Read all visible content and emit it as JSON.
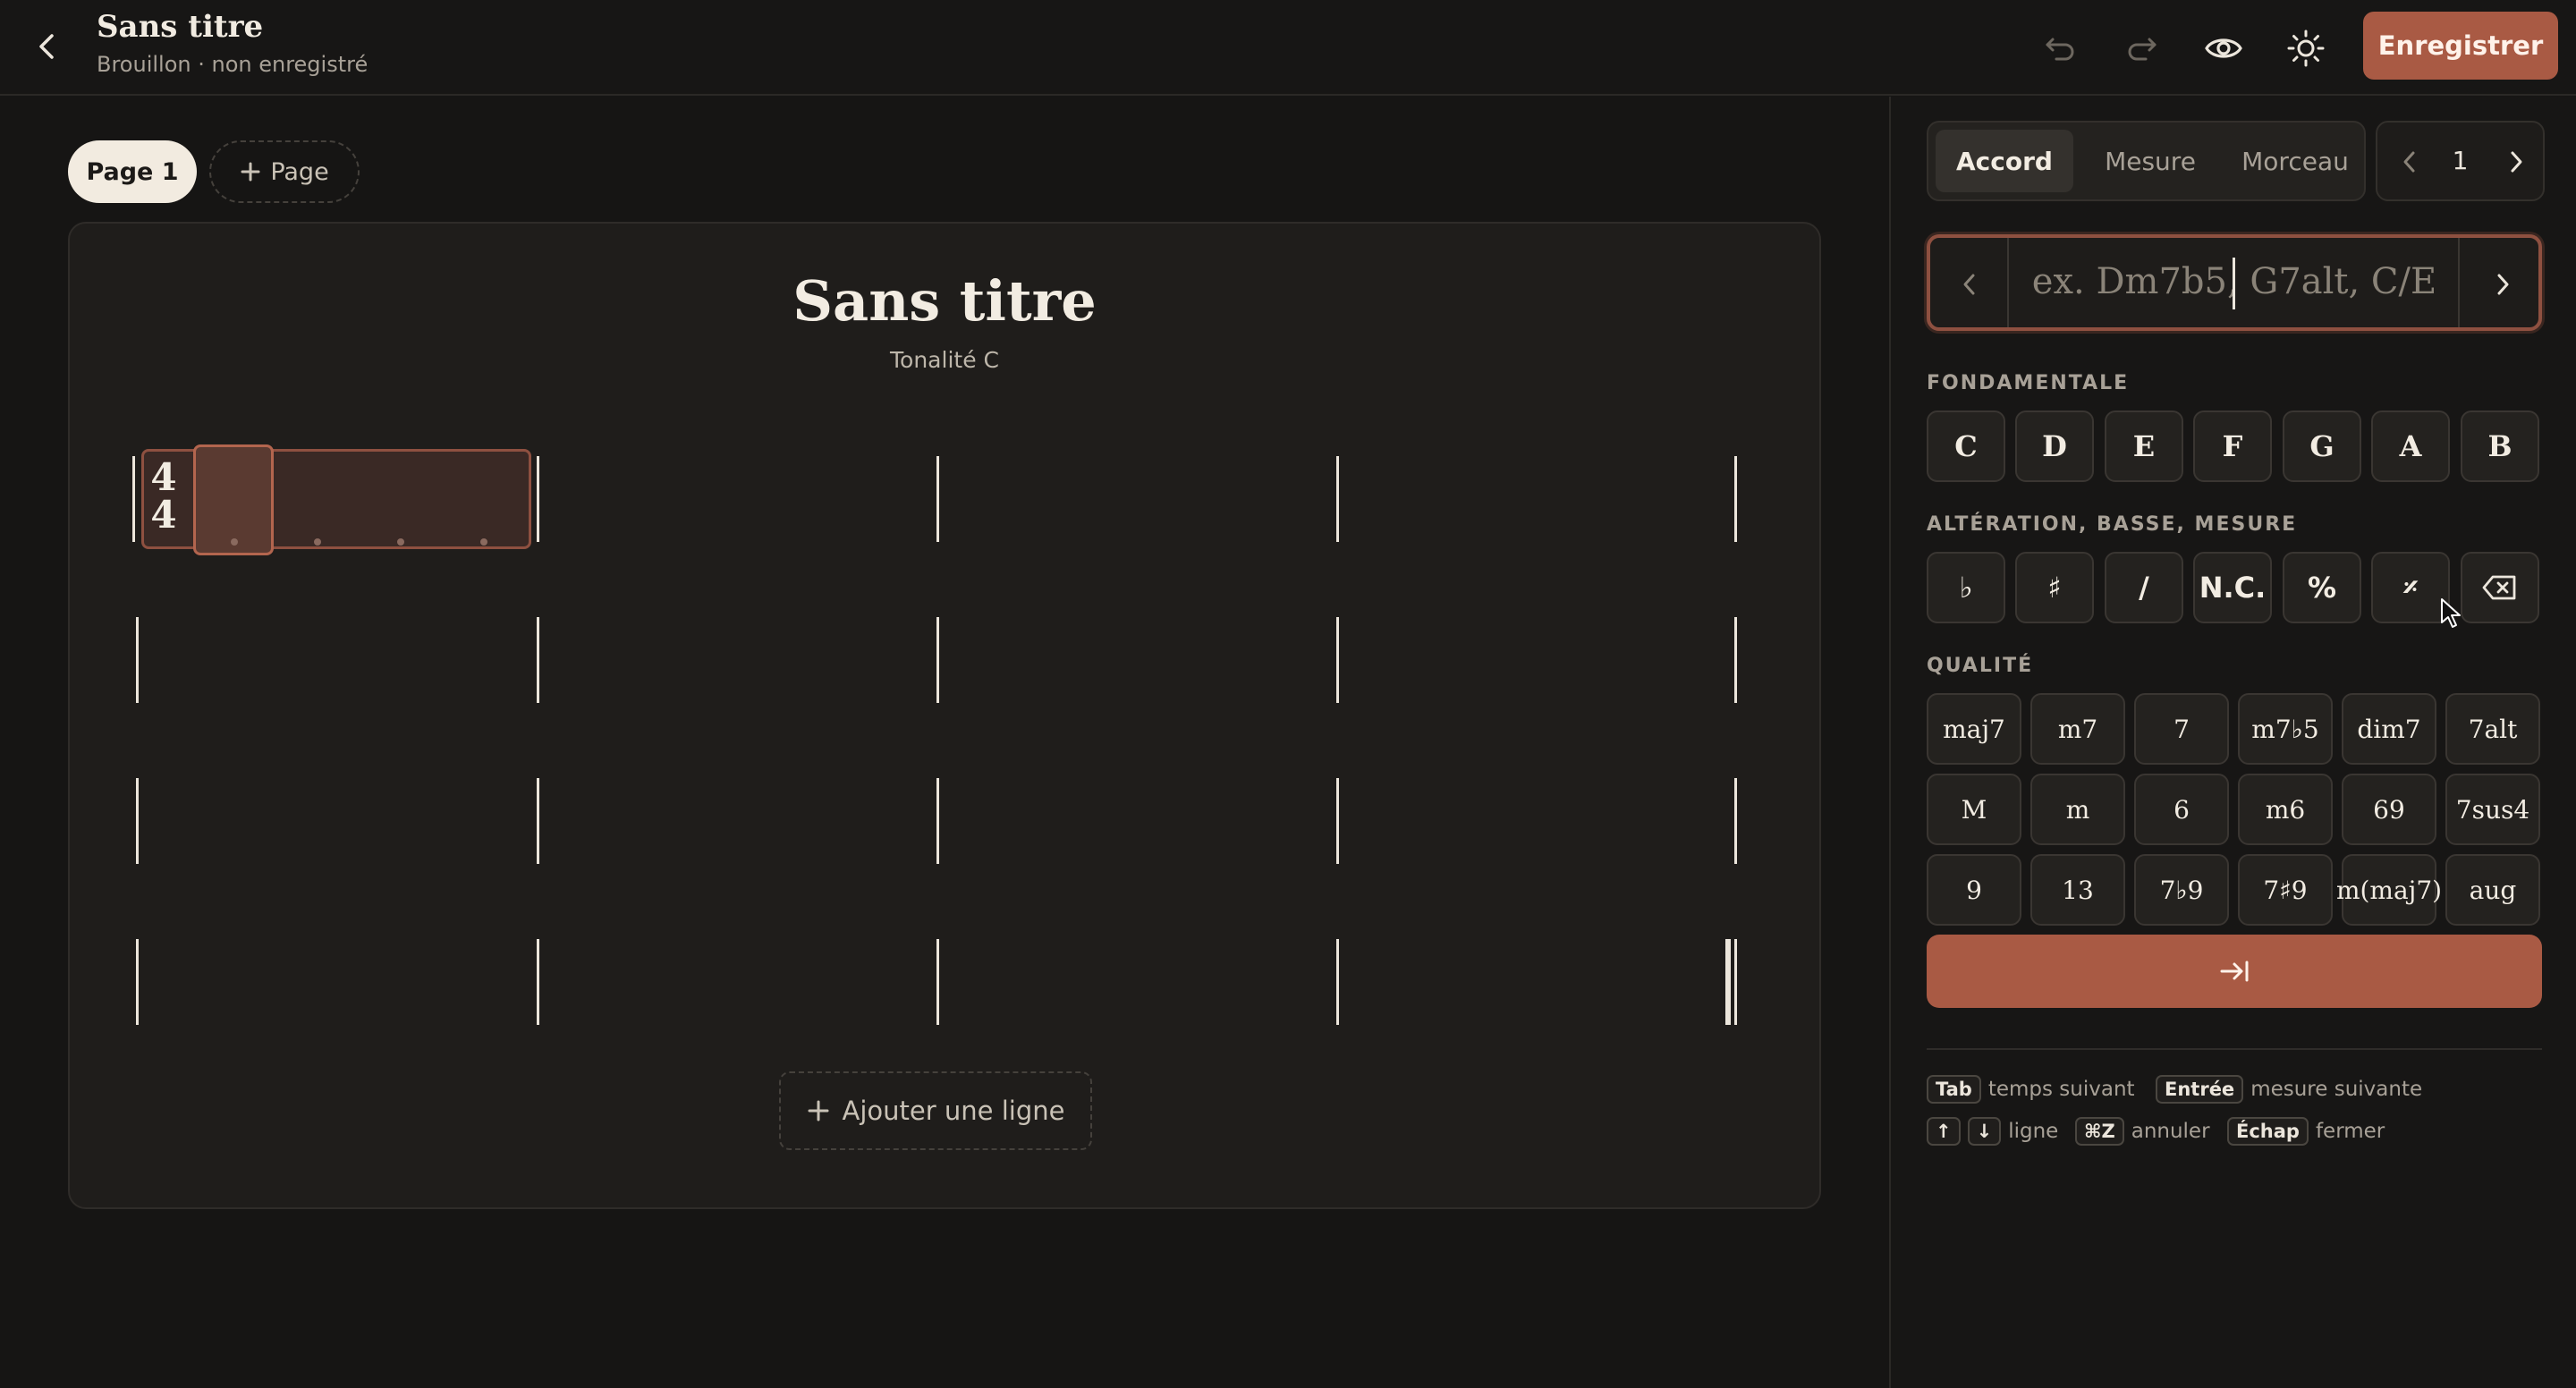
{
  "header": {
    "title": "Sans titre",
    "subtitle": "Brouillon · non enregistré",
    "save_label": "Enregistrer"
  },
  "pages": {
    "tabs": [
      "Page 1"
    ],
    "add_label": "Page"
  },
  "score": {
    "title": "Sans titre",
    "key": "Tonalité C",
    "time_signature": {
      "top": "4",
      "bottom": "4"
    },
    "rows": 4,
    "measures_per_row": 4,
    "add_line_label": "Ajouter une ligne"
  },
  "panel": {
    "segments": [
      "Accord",
      "Mesure",
      "Morceau"
    ],
    "active_segment": "Accord",
    "page_number": "1",
    "chord_input_placeholder": "ex. Dm7b5, G7alt, C/E",
    "sections": {
      "root": "FONDAMENTALE",
      "alteration": "ALTÉRATION, BASSE, MESURE",
      "quality": "QUALITÉ"
    },
    "root_keys": [
      "C",
      "D",
      "E",
      "F",
      "G",
      "A",
      "B"
    ],
    "alteration_keys": [
      "♭",
      "♯",
      "/",
      "N.C.",
      "%",
      "𝄎"
    ],
    "quality_keys": [
      [
        "maj7",
        "m7",
        "7",
        "m7♭5",
        "dim7",
        "7alt"
      ],
      [
        "M",
        "m",
        "6",
        "m6",
        "69",
        "7sus4"
      ],
      [
        "9",
        "13",
        "7♭9",
        "7♯9",
        "m(maj7)",
        "aug"
      ]
    ],
    "shortcuts": [
      {
        "keys": [
          "Tab"
        ],
        "label": "temps suivant"
      },
      {
        "keys": [
          "Entrée"
        ],
        "label": "mesure suivante"
      },
      {
        "keys": [
          "↑",
          "↓"
        ],
        "label": "ligne"
      },
      {
        "keys": [
          "⌘Z"
        ],
        "label": "annuler"
      },
      {
        "keys": [
          "Échap"
        ],
        "label": "fermer"
      }
    ]
  }
}
